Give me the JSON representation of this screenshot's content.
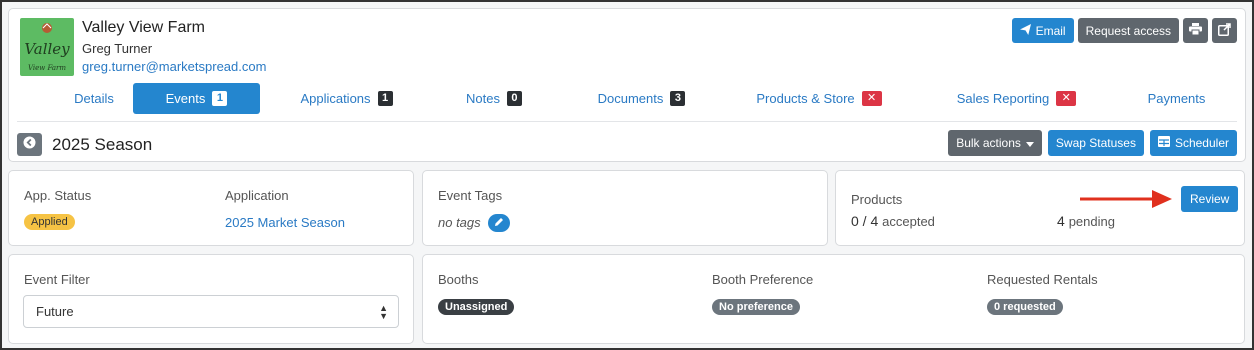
{
  "header": {
    "farm_name": "Valley View Farm",
    "owner": "Greg Turner",
    "email": "greg.turner@marketspread.com",
    "logo_text_1": "Valley",
    "logo_text_2": "View Farm",
    "buttons": {
      "email": "Email",
      "request_access": "Request access",
      "print_icon": "print-icon",
      "external_icon": "external-link-icon"
    }
  },
  "tabs": [
    {
      "label": "Details",
      "count": null
    },
    {
      "label": "Events",
      "count": "1",
      "active": true
    },
    {
      "label": "Applications",
      "count": "1"
    },
    {
      "label": "Notes",
      "count": "0"
    },
    {
      "label": "Documents",
      "count": "3"
    },
    {
      "label": "Products & Store",
      "count": "✕",
      "status": "red"
    },
    {
      "label": "Sales Reporting",
      "count": "✕",
      "status": "red"
    },
    {
      "label": "Payments",
      "count": null
    }
  ],
  "season": {
    "title": "2025 Season",
    "bulk_actions": "Bulk actions",
    "swap_statuses": "Swap Statuses",
    "scheduler": "Scheduler"
  },
  "application_card": {
    "status_label": "App. Status",
    "status_value": "Applied",
    "application_label": "Application",
    "application_value": "2025 Market Season"
  },
  "tags_card": {
    "label": "Event Tags",
    "value": "no tags"
  },
  "products_card": {
    "label": "Products",
    "accepted_count": "0 / 4",
    "accepted_text": "accepted",
    "pending_count": "4",
    "pending_text": "pending",
    "review_button": "Review"
  },
  "filter_card": {
    "label": "Event Filter",
    "selected": "Future"
  },
  "booths_card": {
    "booths_label": "Booths",
    "booths_value": "Unassigned",
    "preference_label": "Booth Preference",
    "preference_value": "No preference",
    "rentals_label": "Requested Rentals",
    "rentals_value": "0 requested"
  },
  "colors": {
    "primary": "#2486cf",
    "secondary": "#5f666d",
    "danger": "#dc3545",
    "warning": "#f6c344",
    "arrow": "#e0301e"
  }
}
